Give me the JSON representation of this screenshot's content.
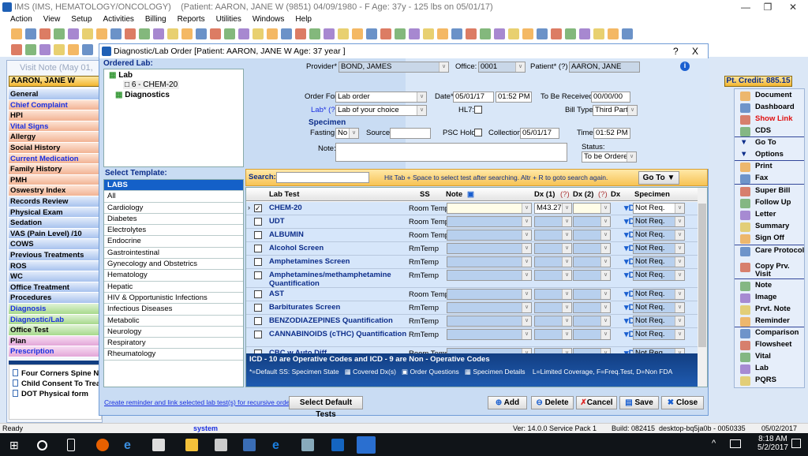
{
  "app": {
    "title": "IMS (IMS, HEMATOLOGY/ONCOLOGY)",
    "patient_info": "(Patient: AARON, JANE W (9851) 04/09/1980 - F Age: 37y  - 125 lbs on 05/01/17)"
  },
  "menu": [
    "Action",
    "View",
    "Setup",
    "Activities",
    "Billing",
    "Reports",
    "Utilities",
    "Windows",
    "Help"
  ],
  "visit_note": {
    "title": "Visit Note (May 01, 2017",
    "patient": "AARON, JANE W",
    "items": [
      {
        "label": "General",
        "c": "b",
        "blue": false
      },
      {
        "label": "Chief Complaint",
        "c": "o",
        "blue": true
      },
      {
        "label": "HPI",
        "c": "o",
        "blue": false
      },
      {
        "label": "Vital Signs",
        "c": "o",
        "blue": true
      },
      {
        "label": "Allergy",
        "c": "o",
        "blue": false
      },
      {
        "label": "Social History",
        "c": "o",
        "blue": false
      },
      {
        "label": "Current Medication",
        "c": "o",
        "blue": true
      },
      {
        "label": "Family History",
        "c": "o",
        "blue": false
      },
      {
        "label": "PMH",
        "c": "o",
        "blue": false
      },
      {
        "label": "Oswestry Index",
        "c": "o",
        "blue": false
      },
      {
        "label": "Records Review",
        "c": "b",
        "blue": false
      },
      {
        "label": "Physical Exam",
        "c": "b",
        "blue": false
      },
      {
        "label": "Sedation",
        "c": "b",
        "blue": false
      },
      {
        "label": "VAS (Pain Level)  /10",
        "c": "b",
        "blue": false
      },
      {
        "label": "COWS",
        "c": "b",
        "blue": false
      },
      {
        "label": "Previous Treatments",
        "c": "b",
        "blue": false
      },
      {
        "label": "ROS",
        "c": "b",
        "blue": false
      },
      {
        "label": "WC",
        "c": "b",
        "blue": false
      },
      {
        "label": "Office Treatment",
        "c": "b",
        "blue": false
      },
      {
        "label": "Procedures",
        "c": "b",
        "blue": false
      },
      {
        "label": "Diagnosis",
        "c": "g",
        "blue": true
      },
      {
        "label": "Diagnostic/Lab",
        "c": "g",
        "blue": true
      },
      {
        "label": "Office Test",
        "c": "g",
        "blue": false
      },
      {
        "label": "Plan",
        "c": "p",
        "blue": false
      },
      {
        "label": "Prescription",
        "c": "p",
        "blue": true
      }
    ],
    "documents": [
      "Four Corners Spine New",
      "Child Consent To Treat",
      "DOT Physical form"
    ]
  },
  "dialog": {
    "title": "Diagnostic/Lab Order  [Patient: AARON, JANE W  Age: 37 year ]",
    "help": "?",
    "close": "X",
    "ordered_lab_label": "Ordered Lab:",
    "tree": {
      "lab": "Lab",
      "lab_item": "6 - CHEM-20",
      "diagnostics": "Diagnostics"
    },
    "form": {
      "provider_label": "Provider*",
      "provider": "BOND, JAMES",
      "office_label": "Office:",
      "office": "0001",
      "patient_label": "Patient* (?)",
      "patient": "AARON, JANE",
      "order_for_label": "Order For*",
      "order_for": "Lab order",
      "date_label": "Date*",
      "date": "05/01/17",
      "time": "01:52 PM",
      "to_be_received_label": "To Be Received:",
      "to_be_received": "00/00/00",
      "lab_label": "Lab* (?)",
      "lab": "Lab of your choice",
      "hl7_label": "HL7:",
      "bill_type_label": "Bill Type:",
      "bill_type": "Third Party",
      "specimen_label": "Specimen",
      "fasting_label": "Fasting:",
      "fasting": "No",
      "source_label": "Source:",
      "source": "",
      "psc_hold_label": "PSC Hold:",
      "collection_label": "Collection:",
      "collection": "05/01/17",
      "time_label": "Time:",
      "collection_time": "01:52 PM",
      "note_label": "Note:",
      "note": "",
      "status_label": "Status:",
      "status": "To be Ordered"
    },
    "template_label": "Select Template:",
    "templates": [
      "LABS",
      "All",
      "Cardiology",
      "Diabetes",
      "Electrolytes",
      "Endocrine",
      "Gastrointestinal",
      "Gynecology and Obstetrics",
      "Hematology",
      "Hepatic",
      "HIV & Opportunistic Infections",
      "Infectious Diseases",
      "Metabolic",
      "Neurology",
      "Respiratory",
      "Rheumatology"
    ],
    "search": {
      "label": "Search:",
      "value": "",
      "hint": "Hit Tab + Space to select test after searching. Altr + R to goto search again.",
      "goto": "Go To"
    },
    "columns": {
      "lab_test": "Lab Test",
      "ss": "SS",
      "note": "Note",
      "dx1": "Dx (1)",
      "dx2": "Dx (2)",
      "q": "(?)",
      "dx": "Dx",
      "specimen": "Specimen"
    },
    "rows": [
      {
        "name": "CHEM-20",
        "ss": "Room Temp.",
        "dx1": "M43.27",
        "specimen": "Not Req.",
        "checked": true
      },
      {
        "name": "UDT",
        "ss": "Room Temp.",
        "dx1": "",
        "specimen": "Not Req.",
        "checked": false
      },
      {
        "name": "ALBUMIN",
        "ss": "Room Temp.",
        "dx1": "",
        "specimen": "Not Req.",
        "checked": false
      },
      {
        "name": "Alcohol Screen",
        "ss": "RmTemp",
        "dx1": "",
        "specimen": "Not Req.",
        "checked": false
      },
      {
        "name": "Amphetamines Screen",
        "ss": "RmTemp",
        "dx1": "",
        "specimen": "Not Req.",
        "checked": false
      },
      {
        "name": "Amphetamines/methamphetamine Quantification",
        "ss": "RmTemp",
        "dx1": "",
        "specimen": "Not Req.",
        "checked": false
      },
      {
        "name": "AST",
        "ss": "Room Temp.",
        "dx1": "",
        "specimen": "Not Req.",
        "checked": false
      },
      {
        "name": "Barbiturates Screen",
        "ss": "RmTemp",
        "dx1": "",
        "specimen": "Not Req.",
        "checked": false
      },
      {
        "name": "BENZODIAZEPINES Quantification",
        "ss": "RmTemp",
        "dx1": "",
        "specimen": "Not Req.",
        "checked": false
      },
      {
        "name": "CANNABINOIDS (cTHC) Quantification",
        "ss": "RmTemp",
        "dx1": "",
        "specimen": "Not Req.",
        "checked": false
      },
      {
        "name": "CBC w Auto Diff",
        "ss": "Room Temp.",
        "dx1": "",
        "specimen": "Not Req.",
        "checked": false
      }
    ],
    "footer": {
      "icd": "ICD - 10 are Operative Codes and ICD - 9 are Non - Operative Codes",
      "default": "*=Default  SS: Specimen State",
      "covered": "Covered Dx(s)",
      "questions": "Order Questions",
      "specimen_details": "Specimen Details",
      "legend": "L=Limited Coverage, F=Freq.Test, D=Non FDA"
    },
    "buttons": {
      "link": "Create reminder and link selected lab test(s) for recursive order.",
      "defaults": "Select Default Tests",
      "add": "Add",
      "delete": "Delete",
      "cancel": "Cancel",
      "save": "Save",
      "close": "Close"
    }
  },
  "right_panel": {
    "credit": "Pt. Credit: 885.15",
    "items": [
      "Document",
      "Dashboard",
      "Show Link",
      "CDS",
      "Go To",
      "Options",
      "Print",
      "Fax",
      "Super Bill",
      "Follow Up",
      "Letter",
      "Summary",
      "Sign Off",
      "Care Protocol",
      "Copy Prv. Visit",
      "Note",
      "Image",
      "Prvt. Note",
      "Reminder",
      "Comparison",
      "Flowsheet",
      "Vital",
      "Lab",
      "PQRS"
    ]
  },
  "statusbar": {
    "status": "Ready",
    "user": "system",
    "version": "Ver: 14.0.0 Service Pack 1",
    "build": "Build: 082415",
    "machine": "desktop-bq5ja0b - 0050335",
    "date": "05/02/2017"
  },
  "taskbar": {
    "time": "8:18 AM",
    "date": "5/2/2017"
  },
  "colors": {
    "accent": "#1460c8",
    "footer": "#123e82",
    "search_bar": "#f7c354"
  }
}
